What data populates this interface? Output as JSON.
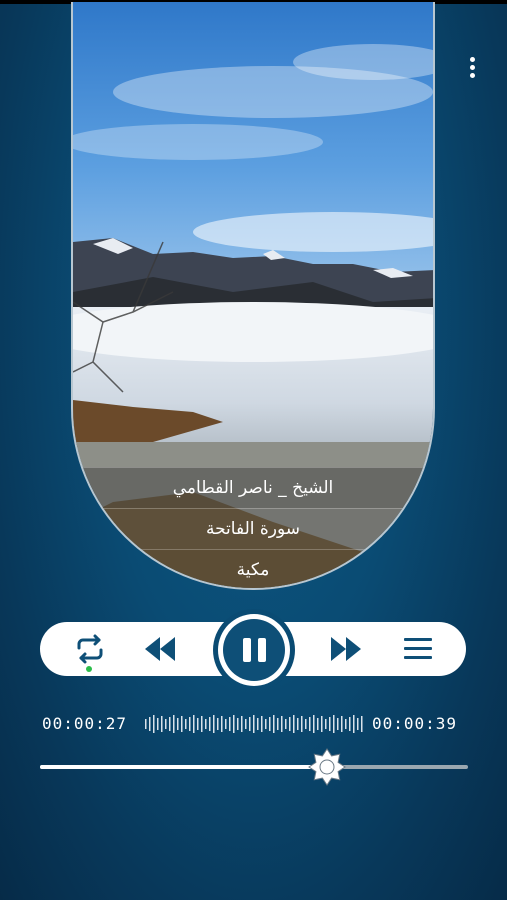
{
  "app": {
    "menu_icon": "more-vertical-icon"
  },
  "artwork": {
    "reciter": "الشيخ _ ناصر القطامي",
    "surah": "سورة الفاتحة",
    "revelation": "مكية"
  },
  "player": {
    "repeat_icon": "repeat-icon",
    "repeat_active_color": "#2bbd4a",
    "previous_icon": "rewind-icon",
    "play_pause_icon": "pause-icon",
    "next_icon": "fast-forward-icon",
    "playlist_icon": "menu-icon",
    "current_time": "00:00:27",
    "total_time": "00:00:39",
    "progress": 0.67,
    "accent_color": "#0e4f77"
  }
}
